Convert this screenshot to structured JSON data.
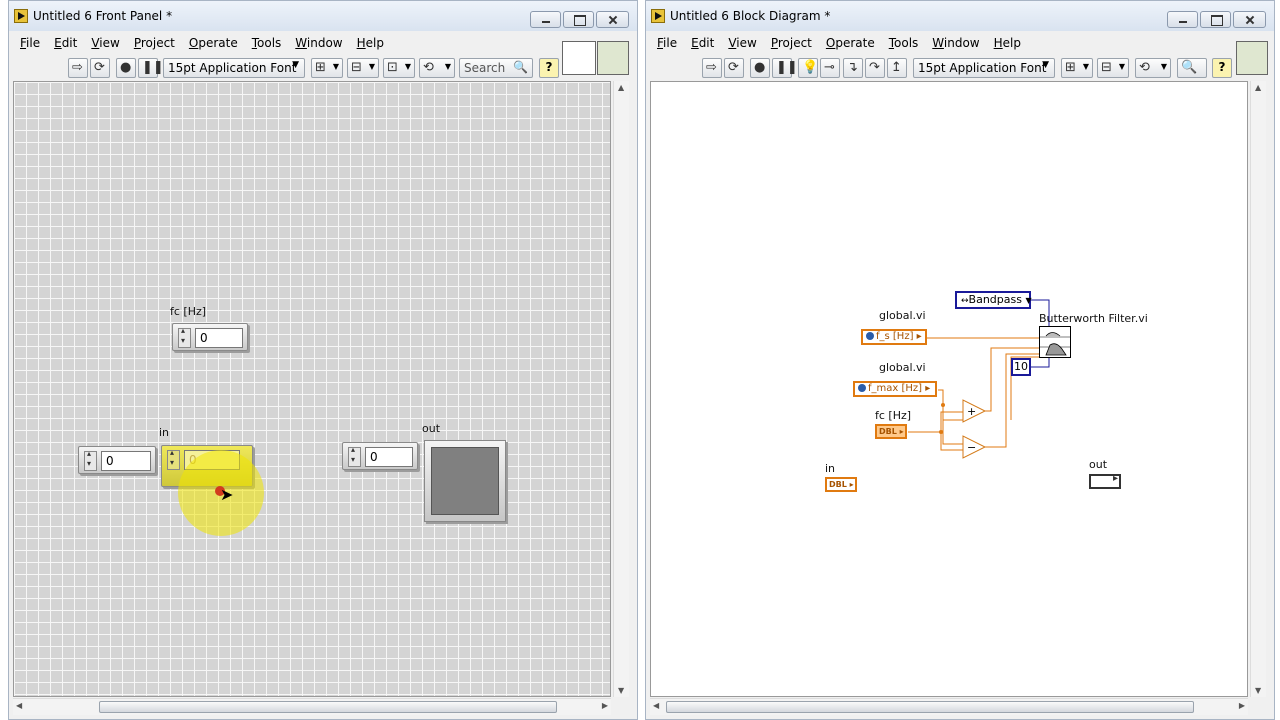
{
  "front_panel": {
    "title": "Untitled 6 Front Panel *",
    "menu": [
      "File",
      "Edit",
      "View",
      "Project",
      "Operate",
      "Tools",
      "Window",
      "Help"
    ],
    "toolbar": {
      "font": "15pt Application Font",
      "search": "Search",
      "help": "?"
    },
    "controls": {
      "fc_label": "fc [Hz]",
      "fc_value": "0",
      "in_label": "in",
      "left_value": "0",
      "in_value": "0",
      "out_label": "out",
      "out_input_value": "0"
    }
  },
  "block_diagram": {
    "title": "Untitled 6 Block Diagram *",
    "menu": [
      "File",
      "Edit",
      "View",
      "Project",
      "Operate",
      "Tools",
      "Window",
      "Help"
    ],
    "toolbar": {
      "font": "15pt Application Font",
      "help": "?"
    },
    "nodes": {
      "ring": "Bandpass",
      "vi_label": "Butterworth Filter.vi",
      "global1_label": "global.vi",
      "global1_term": "f_s [Hz]",
      "global2_label": "global.vi",
      "global2_term": "f_max [Hz]",
      "fc_label": "fc [Hz]",
      "fc_term": "DBL",
      "order_const": "10",
      "in_label": "in",
      "in_term": "DBL",
      "out_label": "out",
      "add_op": "+",
      "sub_op": "−"
    }
  },
  "colors": {
    "wire_orange": "#e07a10",
    "wire_blue": "#1a1a99",
    "highlight": "#f0e600",
    "canvas_gray": "#d4d4d4"
  },
  "icons": [
    "run-arrow-icon",
    "run-continuous-icon",
    "abort-icon",
    "pause-icon",
    "highlight-bulb-icon",
    "align-icon",
    "distribute-icon",
    "resize-icon",
    "reorder-icon",
    "search-icon",
    "help-icon"
  ]
}
